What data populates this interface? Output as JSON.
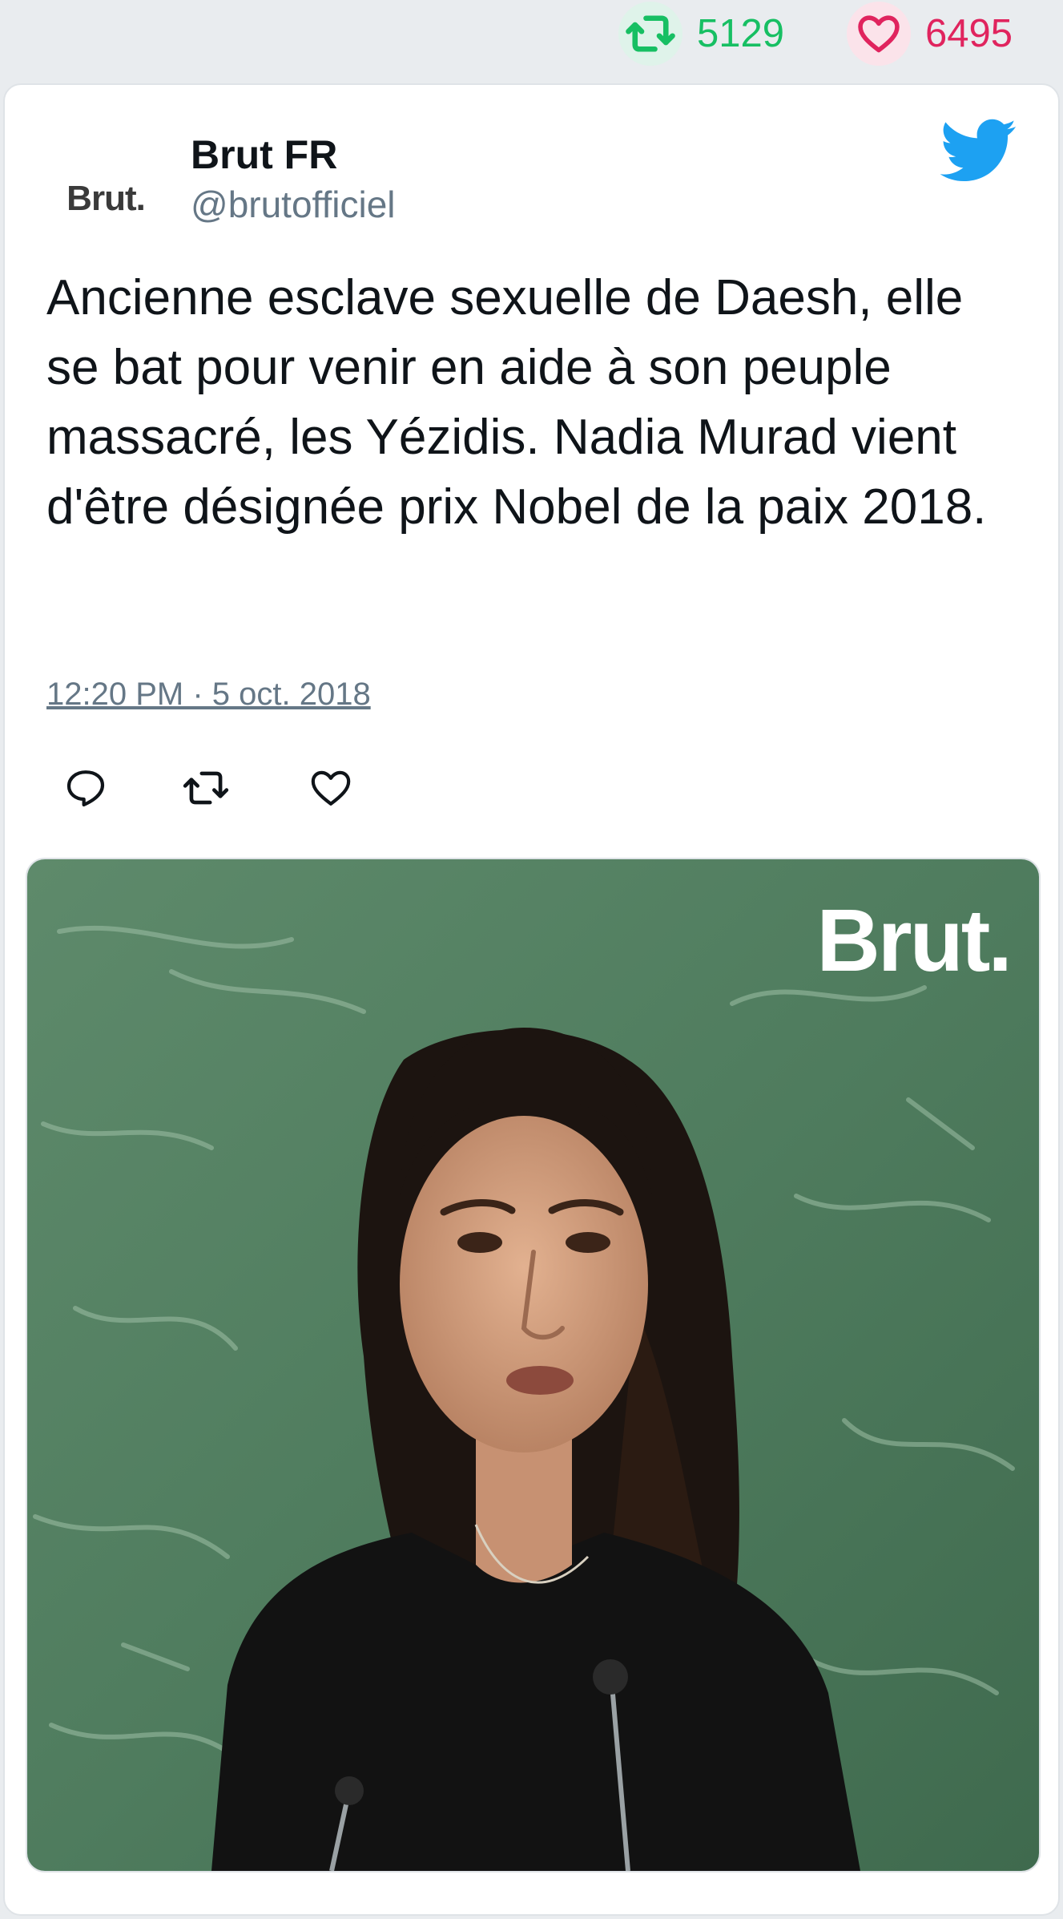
{
  "stats": {
    "retweet_count": "5129",
    "like_count": "6495",
    "retweet_color": "#17bf63",
    "like_color": "#e0245e"
  },
  "tweet": {
    "avatar_logo_text": "Brut.",
    "display_name": "Brut FR",
    "handle": "@brutofficiel",
    "platform_icon": "twitter-bird-icon",
    "text": "Ancienne esclave sexuelle de Daesh, elle se bat pour venir en aide à son peuple massacré, les Yézidis. Nadia Murad vient d'être désignée prix Nobel de la paix 2018.",
    "timestamp": "12:20 PM · 5 oct. 2018",
    "actions": [
      "reply-icon",
      "retweet-icon",
      "like-icon"
    ]
  },
  "media": {
    "watermark": "Brut.",
    "description_icon": "photo"
  }
}
